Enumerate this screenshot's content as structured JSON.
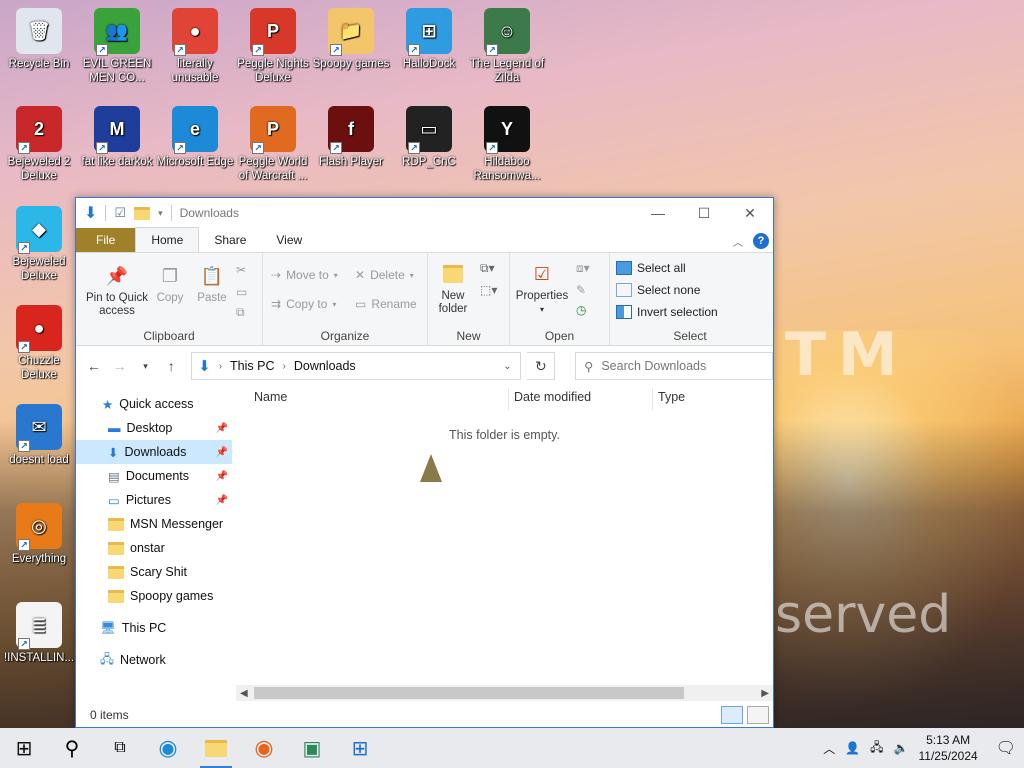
{
  "desktop": {
    "icons": [
      {
        "label": "Recycle Bin",
        "glyph": "🗑",
        "color": "#dfe6ee"
      },
      {
        "label": "EVIL GREEN MEN CO...",
        "glyph": "👥",
        "color": "#3aa23a"
      },
      {
        "label": "literally unusable",
        "glyph": "●",
        "color": "#e04436"
      },
      {
        "label": "Peggle Nights Deluxe",
        "glyph": "P",
        "color": "#d8382a"
      },
      {
        "label": "Spoopy games",
        "glyph": "📁",
        "color": "#f3c66b"
      },
      {
        "label": "HalloDock",
        "glyph": "⊞",
        "color": "#2f9be0"
      },
      {
        "label": "The Legend of Zilda",
        "glyph": "☺",
        "color": "#3c7a4a"
      },
      {
        "label": "Bejeweled 2 Deluxe",
        "glyph": "2",
        "color": "#c8282a"
      },
      {
        "label": "fat like darkok",
        "glyph": "M",
        "color": "#1f3d9a"
      },
      {
        "label": "Microsoft Edge",
        "glyph": "e",
        "color": "#1c8ad6"
      },
      {
        "label": "Peggle World of Warcraft ...",
        "glyph": "P",
        "color": "#e06a20"
      },
      {
        "label": "Flash Player",
        "glyph": "f",
        "color": "#6b0f0f"
      },
      {
        "label": "RDP_CnC",
        "glyph": "▭",
        "color": "#222222"
      },
      {
        "label": "Hildaboo Ransomwa...",
        "glyph": "Y",
        "color": "#111111"
      },
      {
        "label": "Bejeweled Deluxe",
        "glyph": "◆",
        "color": "#2bb7e8"
      },
      {
        "label": "Chuzzle Deluxe",
        "glyph": "●",
        "color": "#d8261e"
      },
      {
        "label": "doesnt load",
        "glyph": "✉",
        "color": "#2a77d0"
      },
      {
        "label": "Everything",
        "glyph": "◎",
        "color": "#e87a18"
      },
      {
        "label": "!INSTALLIN...",
        "glyph": "≣",
        "color": "#f4f4f4"
      }
    ],
    "wallpaper_text": [
      "TM",
      "served"
    ]
  },
  "explorer": {
    "title": "Downloads",
    "tabs": [
      "File",
      "Home",
      "Share",
      "View"
    ],
    "help": "?",
    "ribbon": {
      "clipboard": {
        "label": "Clipboard",
        "pin": "Pin to Quick access",
        "copy": "Copy",
        "paste": "Paste"
      },
      "organize": {
        "label": "Organize",
        "move_to": "Move to",
        "copy_to": "Copy to",
        "delete": "Delete",
        "rename": "Rename"
      },
      "new": {
        "label": "New",
        "new_folder": "New folder"
      },
      "open": {
        "label": "Open",
        "properties": "Properties"
      },
      "select": {
        "label": "Select",
        "select_all": "Select all",
        "select_none": "Select none",
        "invert": "Invert selection"
      }
    },
    "address": {
      "root": "This PC",
      "current": "Downloads"
    },
    "search_placeholder": "Search Downloads",
    "nav": {
      "quick_access": "Quick access",
      "items": [
        "Desktop",
        "Downloads",
        "Documents",
        "Pictures",
        "MSN Messenger",
        "onstar",
        "Scary Shit",
        "Spoopy games"
      ],
      "this_pc": "This PC",
      "network": "Network"
    },
    "columns": [
      "Name",
      "Date modified",
      "Type"
    ],
    "empty_message": "This folder is empty.",
    "status": "0 items"
  },
  "taskbar": {
    "time": "5:13 AM",
    "date": "11/25/2024"
  }
}
